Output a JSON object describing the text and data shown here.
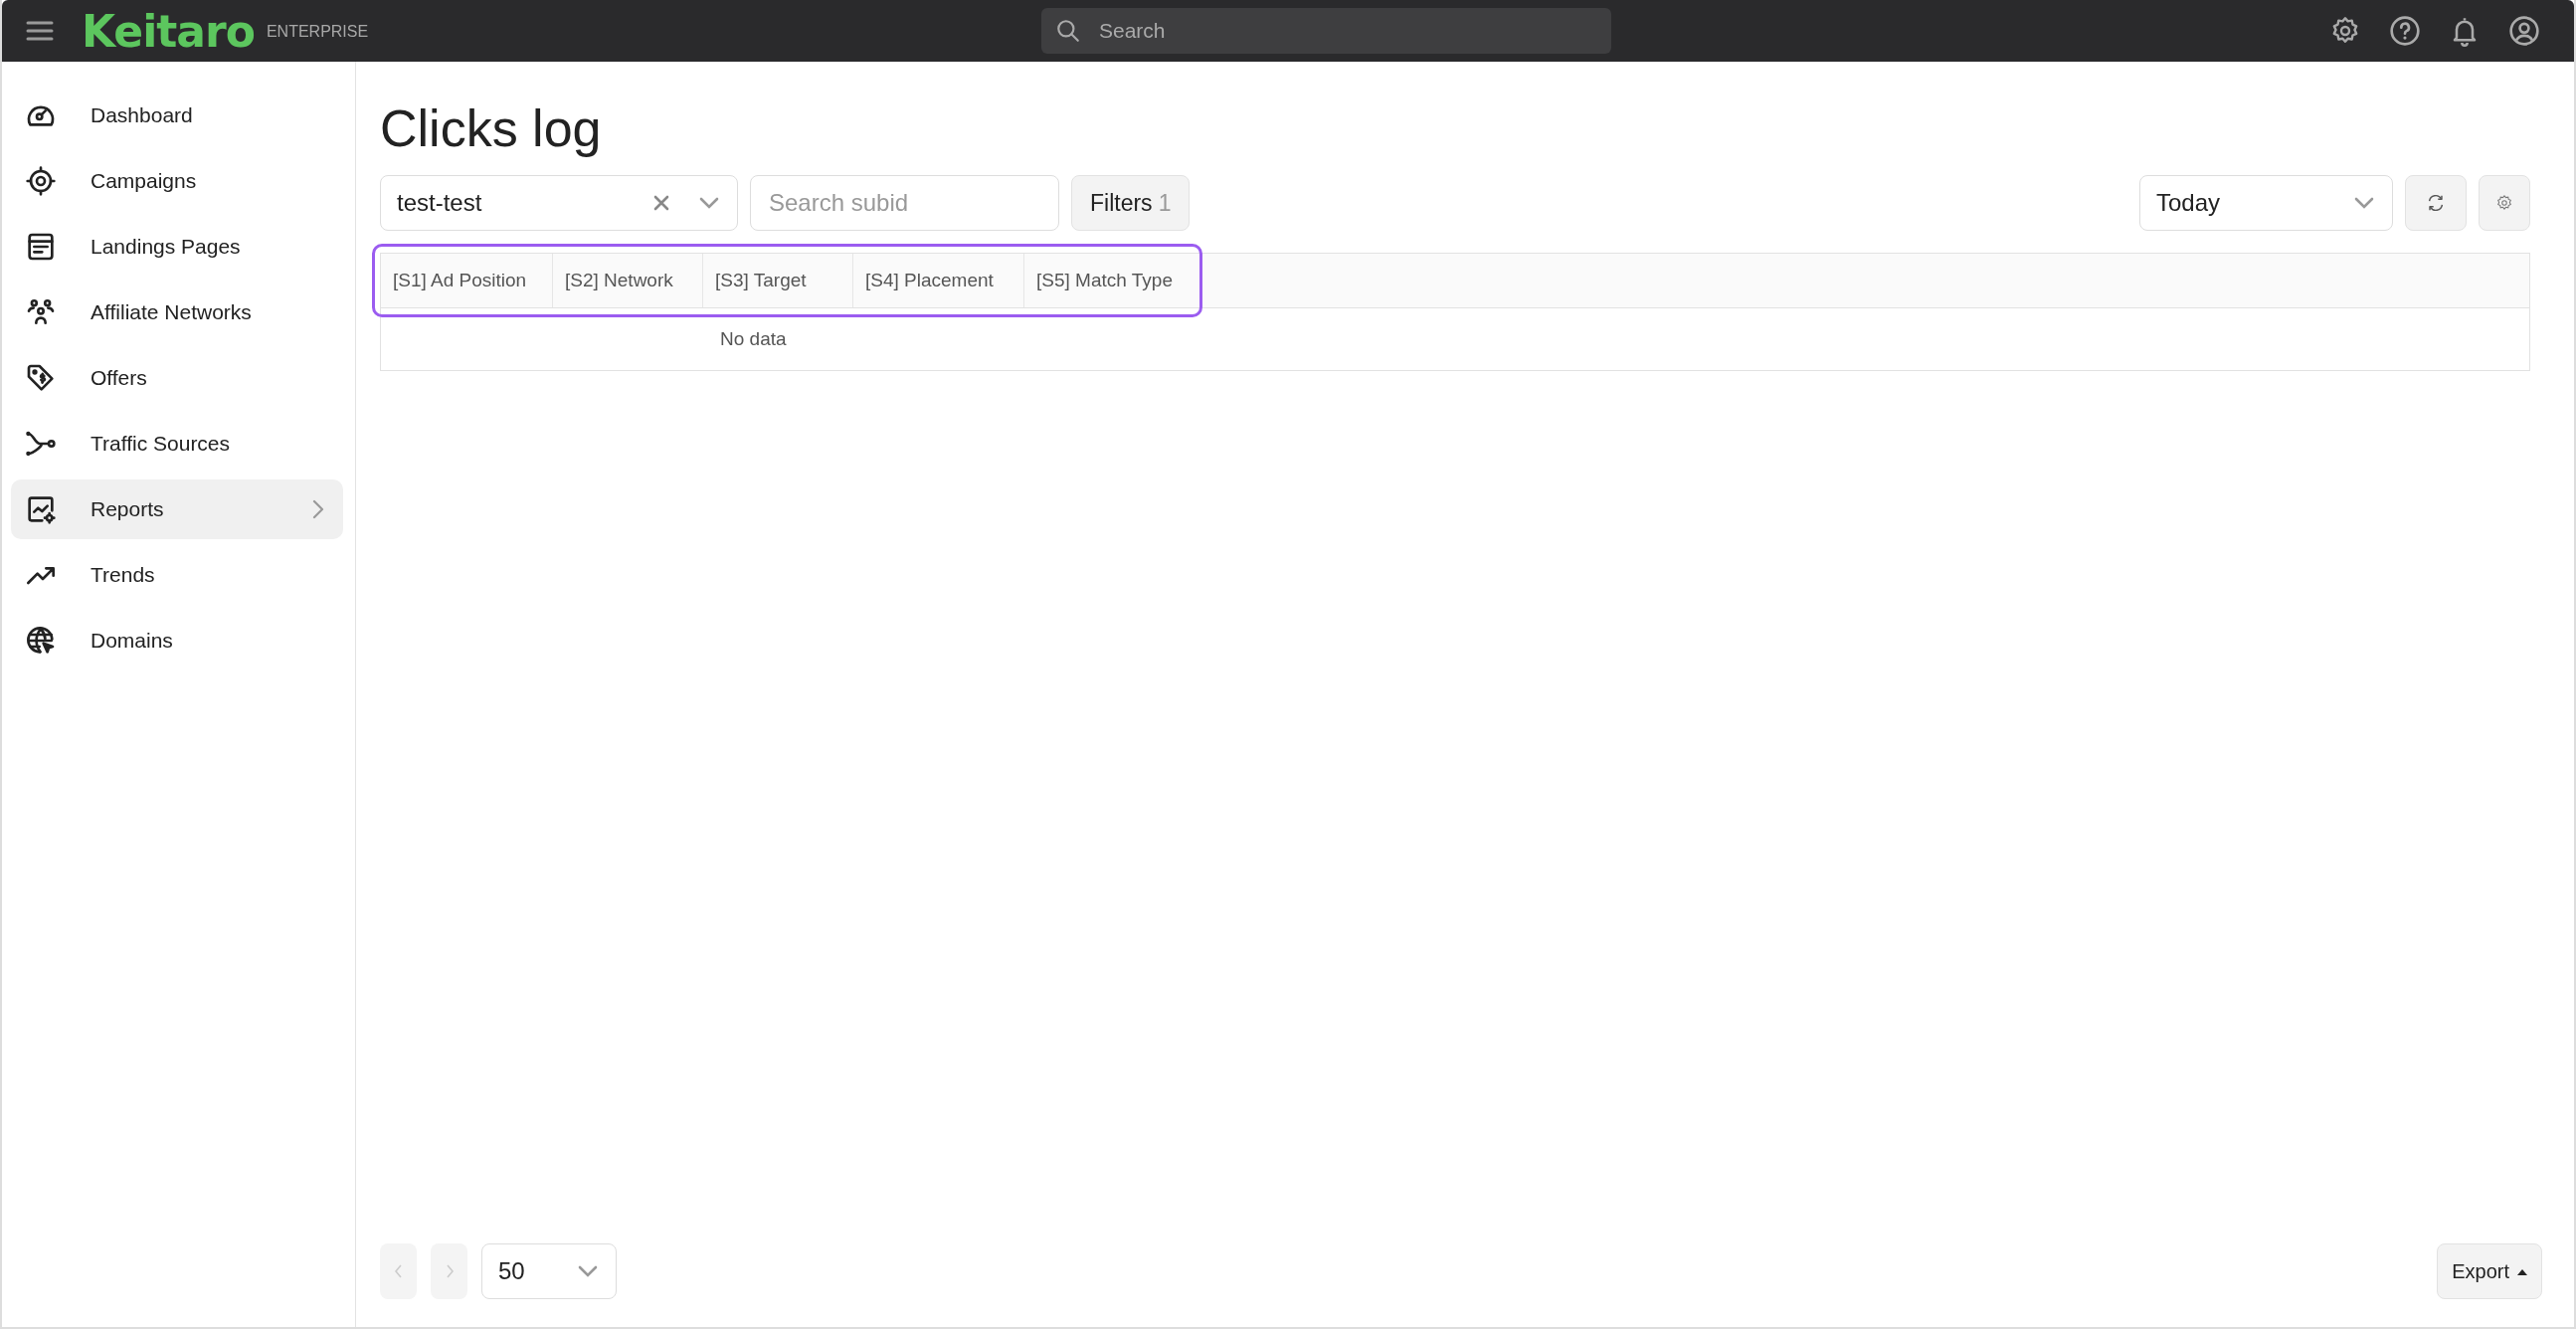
{
  "topbar": {
    "logo": "Keitaro",
    "edition": "ENTERPRISE",
    "search_placeholder": "Search"
  },
  "sidebar": {
    "items": [
      {
        "label": "Dashboard",
        "selected": false,
        "has_submenu": false
      },
      {
        "label": "Campaigns",
        "selected": false,
        "has_submenu": false
      },
      {
        "label": "Landings Pages",
        "selected": false,
        "has_submenu": false
      },
      {
        "label": "Affiliate Networks",
        "selected": false,
        "has_submenu": false
      },
      {
        "label": "Offers",
        "selected": false,
        "has_submenu": false
      },
      {
        "label": "Traffic Sources",
        "selected": false,
        "has_submenu": false
      },
      {
        "label": "Reports",
        "selected": true,
        "has_submenu": true
      },
      {
        "label": "Trends",
        "selected": false,
        "has_submenu": false
      },
      {
        "label": "Domains",
        "selected": false,
        "has_submenu": false
      }
    ]
  },
  "page": {
    "title": "Clicks log"
  },
  "toolbar": {
    "campaign": "test-test",
    "subid_placeholder": "Search subid",
    "filters_label": "Filters",
    "filters_count": "1",
    "period": "Today"
  },
  "table": {
    "columns_highlighted": true,
    "columns": [
      "[S1] Ad Position",
      "[S2] Network",
      "[S3] Target",
      "[S4] Placement",
      "[S5] Match Type"
    ],
    "empty_text": "No data"
  },
  "footer": {
    "prev_disabled": true,
    "next_disabled": true,
    "page_size": "50",
    "export_label": "Export"
  }
}
